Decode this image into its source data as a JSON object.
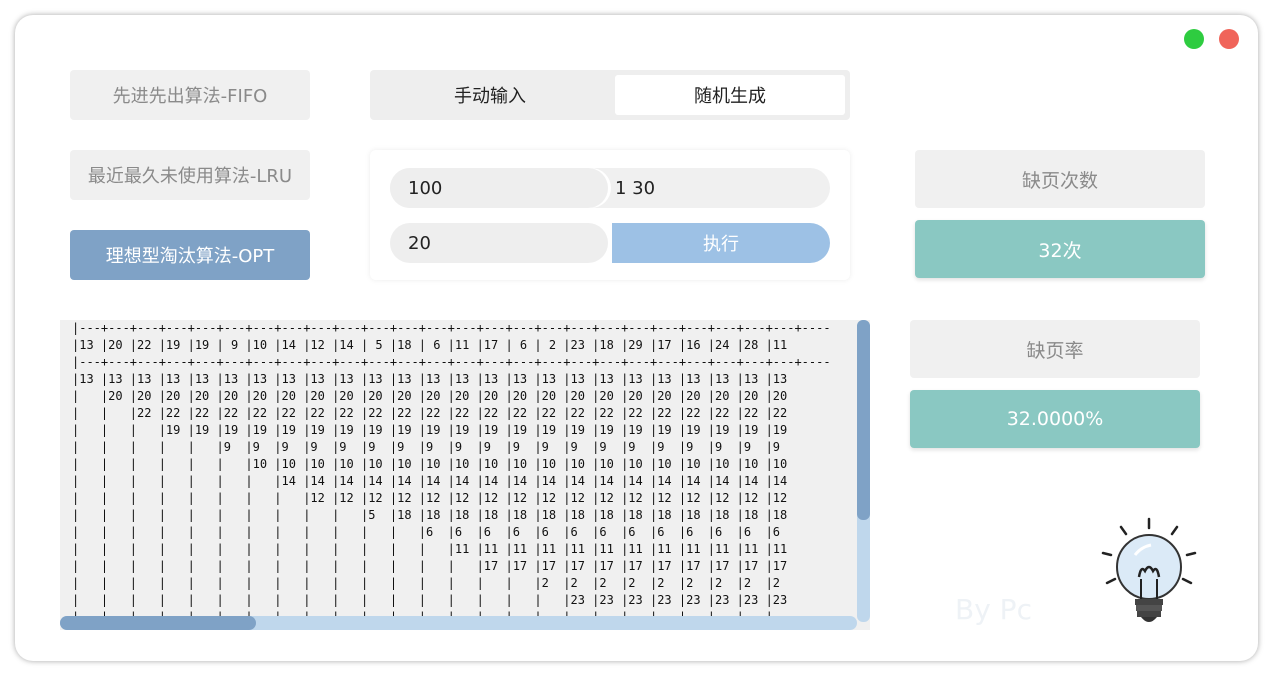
{
  "window": {
    "controls": {
      "minimize_color": "#2ecc40",
      "close_color": "#f0645a"
    }
  },
  "algorithms": [
    {
      "label": "先进先出算法-FIFO",
      "active": false
    },
    {
      "label": "最近最久未使用算法-LRU",
      "active": false
    },
    {
      "label": "理想型淘汰算法-OPT",
      "active": true
    }
  ],
  "mode_tabs": [
    {
      "label": "手动输入",
      "selected": false
    },
    {
      "label": "随机生成",
      "selected": true
    }
  ],
  "inputs": {
    "length_value": "100",
    "range_value": "1 30",
    "frames_value": "20",
    "execute_label": "执行"
  },
  "stats": {
    "fault_count_label": "缺页次数",
    "fault_count_value": "32次",
    "fault_rate_label": "缺页率",
    "fault_rate_value": "32.0000%"
  },
  "output_lines": [
    "|---+---+---+---+---+---+---+---+---+---+---+---+---+---+---+---+---+---+---+---+---+---+---+---+---+----",
    "|13 |20 |22 |19 |19 | 9 |10 |14 |12 |14 | 5 |18 | 6 |11 |17 | 6 | 2 |23 |18 |29 |17 |16 |24 |28 |11",
    "|---+---+---+---+---+---+---+---+---+---+---+---+---+---+---+---+---+---+---+---+---+---+---+---+---+----",
    "|13 |13 |13 |13 |13 |13 |13 |13 |13 |13 |13 |13 |13 |13 |13 |13 |13 |13 |13 |13 |13 |13 |13 |13 |13",
    "|   |20 |20 |20 |20 |20 |20 |20 |20 |20 |20 |20 |20 |20 |20 |20 |20 |20 |20 |20 |20 |20 |20 |20 |20",
    "|   |   |22 |22 |22 |22 |22 |22 |22 |22 |22 |22 |22 |22 |22 |22 |22 |22 |22 |22 |22 |22 |22 |22 |22",
    "|   |   |   |19 |19 |19 |19 |19 |19 |19 |19 |19 |19 |19 |19 |19 |19 |19 |19 |19 |19 |19 |19 |19 |19",
    "|   |   |   |   |   |9  |9  |9  |9  |9  |9  |9  |9  |9  |9  |9  |9  |9  |9  |9  |9  |9  |9  |9  |9",
    "|   |   |   |   |   |   |10 |10 |10 |10 |10 |10 |10 |10 |10 |10 |10 |10 |10 |10 |10 |10 |10 |10 |10",
    "|   |   |   |   |   |   |   |14 |14 |14 |14 |14 |14 |14 |14 |14 |14 |14 |14 |14 |14 |14 |14 |14 |14",
    "|   |   |   |   |   |   |   |   |12 |12 |12 |12 |12 |12 |12 |12 |12 |12 |12 |12 |12 |12 |12 |12 |12",
    "|   |   |   |   |   |   |   |   |   |   |5  |18 |18 |18 |18 |18 |18 |18 |18 |18 |18 |18 |18 |18 |18",
    "|   |   |   |   |   |   |   |   |   |   |   |   |6  |6  |6  |6  |6  |6  |6  |6  |6  |6  |6  |6  |6",
    "|   |   |   |   |   |   |   |   |   |   |   |   |   |11 |11 |11 |11 |11 |11 |11 |11 |11 |11 |11 |11",
    "|   |   |   |   |   |   |   |   |   |   |   |   |   |   |17 |17 |17 |17 |17 |17 |17 |17 |17 |17 |17",
    "|   |   |   |   |   |   |   |   |   |   |   |   |   |   |   |   |2  |2  |2  |2  |2  |2  |2  |2  |2",
    "|   |   |   |   |   |   |   |   |   |   |   |   |   |   |   |   |   |23 |23 |23 |23 |23 |23 |23 |23",
    "|   |   |   |   |   |   |   |   |   |   |   |   |   |   |   |   |   |   |   |   |   |   |   |   |"
  ],
  "watermark": "By Pc",
  "decor": {
    "bulb": "lightbulb-icon"
  }
}
